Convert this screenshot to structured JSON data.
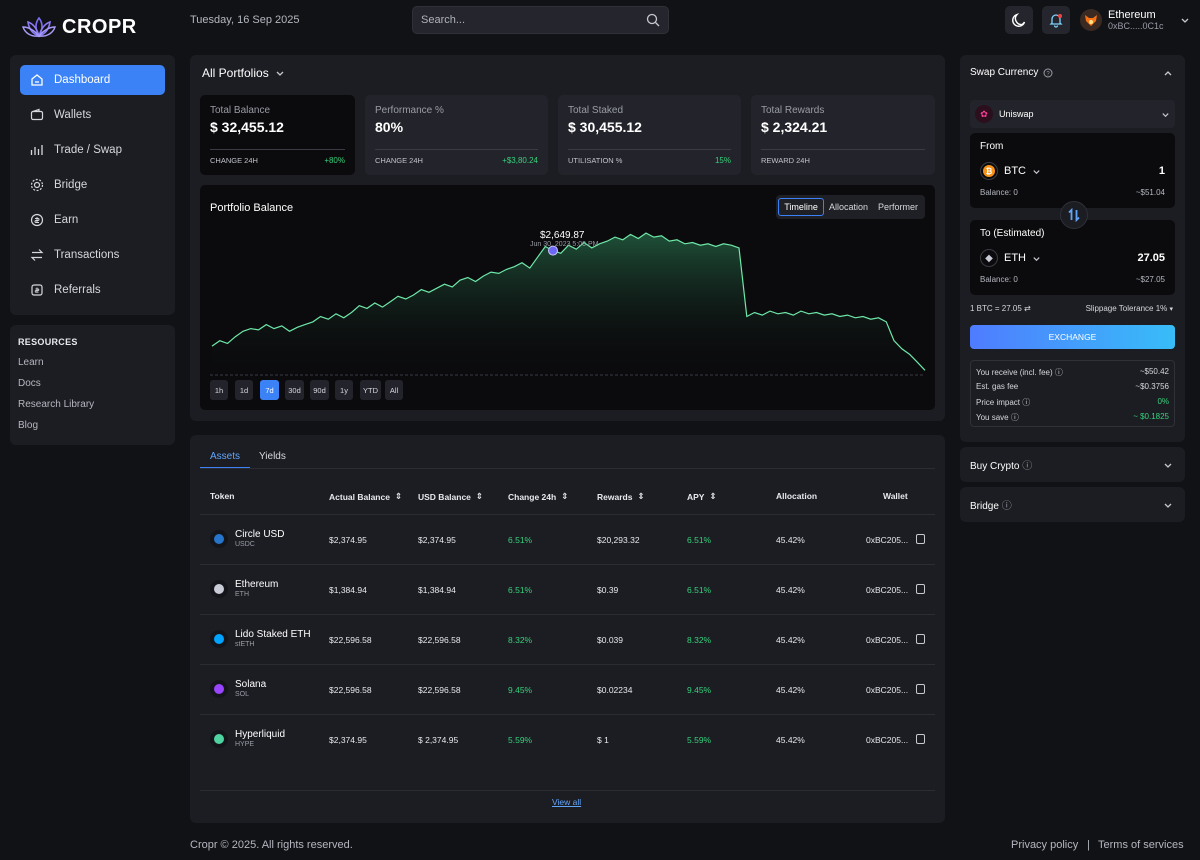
{
  "brand": {
    "name": "CROPR"
  },
  "header": {
    "date": "Tuesday, 16 Sep 2025",
    "search_placeholder": "Search...",
    "account": {
      "network": "Ethereum",
      "address": "0xBC.....0C1c"
    }
  },
  "sidebar": {
    "items": [
      {
        "label": "Dashboard",
        "icon": "home-icon"
      },
      {
        "label": "Wallets",
        "icon": "wallet-icon"
      },
      {
        "label": "Trade / Swap",
        "icon": "trade-icon"
      },
      {
        "label": "Bridge",
        "icon": "bridge-icon"
      },
      {
        "label": "Earn",
        "icon": "earn-icon"
      },
      {
        "label": "Transactions",
        "icon": "transactions-icon"
      },
      {
        "label": "Referrals",
        "icon": "referrals-icon"
      }
    ],
    "resources": {
      "title": "RESOURCES",
      "links": [
        "Learn",
        "Docs",
        "Research Library",
        "Blog"
      ]
    }
  },
  "portfolio": {
    "selector": "All Portfolios",
    "stats": [
      {
        "label": "Total Balance",
        "value": "$ 32,455.12",
        "footer_label": "CHANGE 24H",
        "footer_value": "+80%"
      },
      {
        "label": "Performance %",
        "value": "80%",
        "footer_label": "CHANGE 24H",
        "footer_value": "+$3,80.24"
      },
      {
        "label": "Total Staked",
        "value": "$ 30,455.12",
        "footer_label": "UTILISATION %",
        "footer_value": "15%"
      },
      {
        "label": "Total Rewards",
        "value": "$ 2,324.21",
        "footer_label": "REWARD 24H",
        "footer_value": ""
      }
    ],
    "chart": {
      "title": "Portfolio Balance",
      "views": [
        "Timeline",
        "Allocation",
        "Performer"
      ],
      "timeframes": [
        "1h",
        "1d",
        "7d",
        "30d",
        "90d",
        "1y",
        "YTD",
        "All"
      ],
      "tooltip_value": "$2,649.87",
      "tooltip_date": "Jun 30, 2023 5:00 PM"
    }
  },
  "chart_data": {
    "type": "area",
    "title": "Portfolio Balance",
    "xlabel": "",
    "ylabel": "",
    "series": [
      {
        "values": [
          20,
          24,
          22,
          27,
          31,
          33,
          32,
          36,
          33,
          35,
          31,
          34,
          36,
          38,
          42,
          40,
          44,
          41,
          45,
          50,
          48,
          52,
          49,
          53,
          57,
          55,
          58,
          62,
          60,
          63,
          66,
          64,
          69,
          71,
          68,
          72,
          75,
          74,
          77,
          79,
          82,
          78,
          86,
          94,
          91,
          89,
          95,
          92,
          97,
          93,
          96,
          98,
          101,
          99,
          103,
          100,
          104,
          101,
          102,
          98,
          99,
          96,
          97,
          95,
          96,
          94,
          96,
          95,
          93,
          42,
          45,
          43,
          46,
          44,
          45,
          43,
          46,
          44,
          45,
          43,
          44,
          42,
          43,
          41,
          42,
          40,
          41,
          38,
          24,
          18,
          14,
          8,
          2
        ]
      }
    ],
    "highlight": {
      "index": 44,
      "label": "$2,649.87"
    }
  },
  "assets": {
    "tabs": [
      "Assets",
      "Yields"
    ],
    "columns": [
      "Token",
      "Actual Balance",
      "USD Balance",
      "Change 24h",
      "Rewards",
      "APY",
      "Allocation",
      "Wallet"
    ],
    "rows": [
      {
        "name": "Circle USD",
        "symbol": "USDC",
        "actual": "$2,374.95",
        "usd": "$2,374.95",
        "change": "6.51%",
        "rewards": "$20,293.32",
        "apy": "6.51%",
        "alloc": "45.42%",
        "wallet": "0xBC205...",
        "icon_color": "#2775ca"
      },
      {
        "name": "Ethereum",
        "symbol": "ETH",
        "actual": "$1,384.94",
        "usd": "$1,384.94",
        "change": "6.51%",
        "rewards": "$0.39",
        "apy": "6.51%",
        "alloc": "45.42%",
        "wallet": "0xBC205...",
        "icon_color": "#c9cbd6"
      },
      {
        "name": "Lido Staked ETH",
        "symbol": "stETH",
        "actual": "$22,596.58",
        "usd": "$22,596.58",
        "change": "8.32%",
        "rewards": "$0.039",
        "apy": "8.32%",
        "alloc": "45.42%",
        "wallet": "0xBC205...",
        "icon_color": "#00a3ff"
      },
      {
        "name": "Solana",
        "symbol": "SOL",
        "actual": "$22,596.58",
        "usd": "$22,596.58",
        "change": "9.45%",
        "rewards": "$0.02234",
        "apy": "9.45%",
        "alloc": "45.42%",
        "wallet": "0xBC205...",
        "icon_color": "#9945ff"
      },
      {
        "name": "Hyperliquid",
        "symbol": "HYPE",
        "actual": "$2,374.95",
        "usd": "$ 2,374.95",
        "change": "5.59%",
        "rewards": "$ 1",
        "apy": "5.59%",
        "alloc": "45.42%",
        "wallet": "0xBC205...",
        "icon_color": "#50d2a0"
      }
    ],
    "view_all": "View all"
  },
  "swap": {
    "title": "Swap Currency",
    "dex": "Uniswap",
    "from": {
      "label": "From",
      "coin": "BTC",
      "amount": "1",
      "balance": "Balance: 0",
      "usd": "~$51.04"
    },
    "to": {
      "label": "To (Estimated)",
      "coin": "ETH",
      "amount": "27.05",
      "balance": "Balance: 0",
      "usd": "~$27.05"
    },
    "rate": "1 BTC = 27.05",
    "slippage": "Slippage Tolerance 1%",
    "button": "EXCHANGE",
    "summary": [
      {
        "label": "You receive (incl. fee)",
        "value": "~$50.42",
        "green": false
      },
      {
        "label": "Est. gas fee",
        "value": "~$0.3756",
        "green": false
      },
      {
        "label": "Price impact",
        "value": "0%",
        "green": true
      },
      {
        "label": "You save",
        "value": "~ $0.1825",
        "green": true
      }
    ]
  },
  "panels": {
    "buy": "Buy Crypto",
    "bridge": "Bridge"
  },
  "footer": {
    "copyright": "Cropr © 2025. All rights reserved.",
    "privacy": "Privacy policy",
    "sep": "|",
    "terms": "Terms of services"
  },
  "colors": {
    "accent": "#3b82f6",
    "positive": "#36d17a",
    "background": "#111216",
    "card": "#1c1d23"
  }
}
